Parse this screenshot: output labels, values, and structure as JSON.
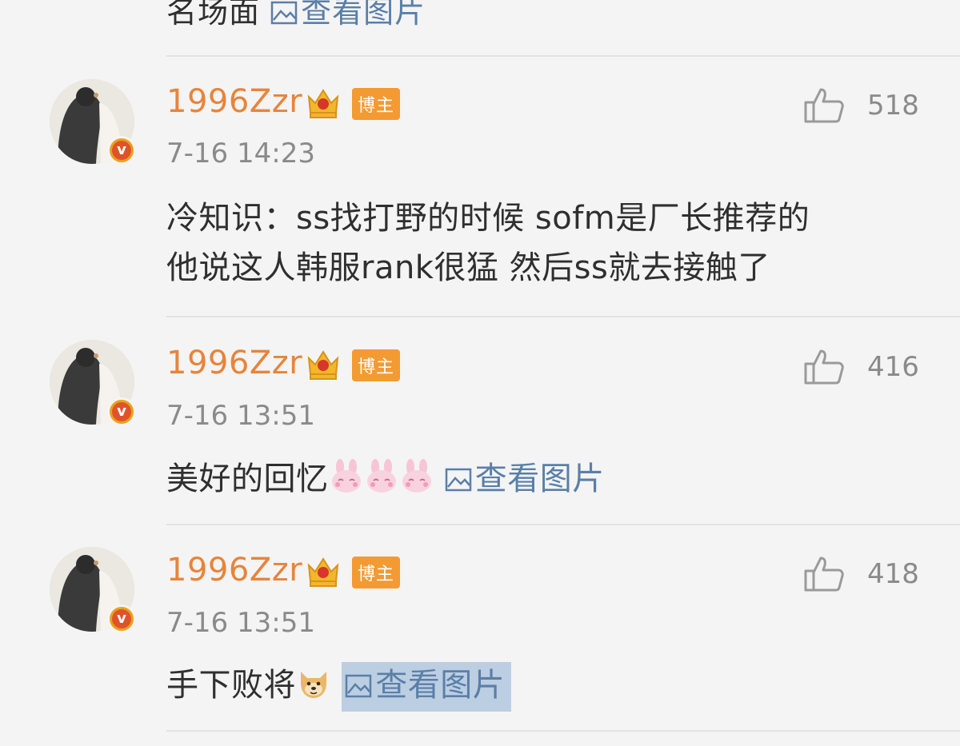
{
  "top_partial": {
    "text": "名场面",
    "view_image_label": "查看图片"
  },
  "comments": [
    {
      "username": "1996Zzr",
      "badge_label": "博主",
      "timestamp": "7-16 14:23",
      "like_count": "518",
      "content_lines": [
        "冷知识：ss找打野的时候 sofm是厂长推荐的",
        "他说这人韩服rank很猛 然后ss就去接触了"
      ]
    },
    {
      "username": "1996Zzr",
      "badge_label": "博主",
      "timestamp": "7-16 13:51",
      "like_count": "416",
      "content_text": "美好的回忆",
      "emoji_icons": [
        "bunny-emoji",
        "bunny-emoji",
        "bunny-emoji"
      ],
      "view_image_label": "查看图片"
    },
    {
      "username": "1996Zzr",
      "badge_label": "博主",
      "timestamp": "7-16 13:51",
      "like_count": "418",
      "content_text": "手下败将",
      "emoji_icons": [
        "doge-emoji"
      ],
      "view_image_label": "查看图片"
    }
  ],
  "colors": {
    "background": "#f4f4f4",
    "username": "#e8843a",
    "badge": "#f39a32",
    "link": "#5a7fa8",
    "meta": "#8a8a8a",
    "highlight": "#bccee2"
  }
}
